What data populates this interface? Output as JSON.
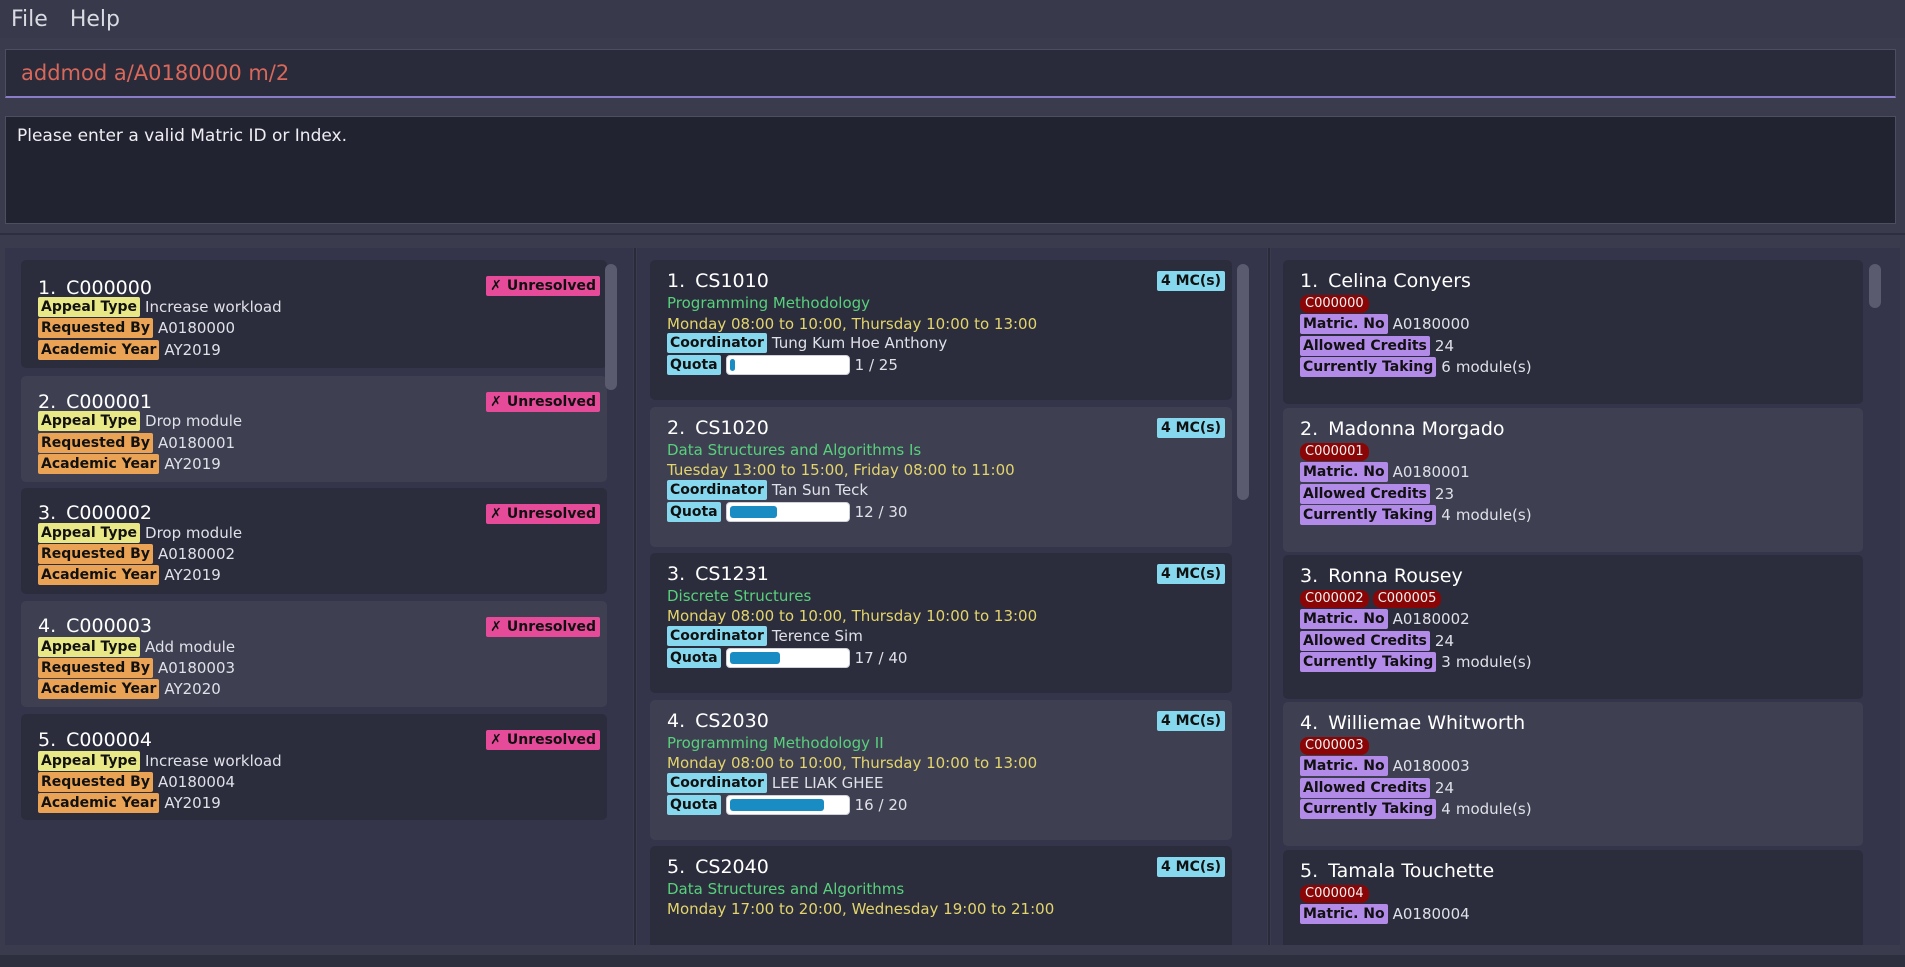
{
  "menu": {
    "file": "File",
    "help": "Help"
  },
  "command": {
    "value": "addmod a/A0180000 m/2"
  },
  "result": {
    "text": "Please enter a valid Matric ID or Index."
  },
  "appeals": [
    {
      "index": "1.",
      "id": "C000000",
      "status": "Unresolved",
      "appeal_type_label": "Appeal Type",
      "appeal_type": "Increase workload",
      "requested_by_label": "Requested By",
      "requested_by": "A0180000",
      "academic_year_label": "Academic Year",
      "academic_year": "AY2019"
    },
    {
      "index": "2.",
      "id": "C000001",
      "status": "Unresolved",
      "appeal_type_label": "Appeal Type",
      "appeal_type": "Drop module",
      "requested_by_label": "Requested By",
      "requested_by": "A0180001",
      "academic_year_label": "Academic Year",
      "academic_year": "AY2019"
    },
    {
      "index": "3.",
      "id": "C000002",
      "status": "Unresolved",
      "appeal_type_label": "Appeal Type",
      "appeal_type": "Drop module",
      "requested_by_label": "Requested By",
      "requested_by": "A0180002",
      "academic_year_label": "Academic Year",
      "academic_year": "AY2019"
    },
    {
      "index": "4.",
      "id": "C000003",
      "status": "Unresolved",
      "appeal_type_label": "Appeal Type",
      "appeal_type": "Add module",
      "requested_by_label": "Requested By",
      "requested_by": "A0180003",
      "academic_year_label": "Academic Year",
      "academic_year": "AY2020"
    },
    {
      "index": "5.",
      "id": "C000004",
      "status": "Unresolved",
      "appeal_type_label": "Appeal Type",
      "appeal_type": "Increase workload",
      "requested_by_label": "Requested By",
      "requested_by": "A0180004",
      "academic_year_label": "Academic Year",
      "academic_year": "AY2019"
    }
  ],
  "modules": [
    {
      "index": "1.",
      "code": "CS1010",
      "mc": "4 MC(s)",
      "name": "Programming Methodology",
      "schedule": "Monday 08:00 to 10:00, Thursday 10:00 to 13:00",
      "coordinator_label": "Coordinator",
      "coordinator": "Tung Kum Hoe Anthony",
      "quota_label": "Quota",
      "quota": "1 / 25",
      "quota_fill": 0.04
    },
    {
      "index": "2.",
      "code": "CS1020",
      "mc": "4 MC(s)",
      "name": "Data Structures and Algorithms Is",
      "schedule": "Tuesday 13:00 to 15:00, Friday 08:00 to 11:00",
      "coordinator_label": "Coordinator",
      "coordinator": "Tan Sun Teck",
      "quota_label": "Quota",
      "quota": "12 / 30",
      "quota_fill": 0.4
    },
    {
      "index": "3.",
      "code": "CS1231",
      "mc": "4 MC(s)",
      "name": "Discrete Structures",
      "schedule": "Monday 08:00 to 10:00, Thursday 10:00 to 13:00",
      "coordinator_label": "Coordinator",
      "coordinator": "Terence Sim",
      "quota_label": "Quota",
      "quota": "17 / 40",
      "quota_fill": 0.425
    },
    {
      "index": "4.",
      "code": "CS2030",
      "mc": "4 MC(s)",
      "name": "Programming Methodology II",
      "schedule": "Monday 08:00 to 10:00, Thursday 10:00 to 13:00",
      "coordinator_label": "Coordinator",
      "coordinator": "LEE LIAK GHEE",
      "quota_label": "Quota",
      "quota": "16 / 20",
      "quota_fill": 0.8
    },
    {
      "index": "5.",
      "code": "CS2040",
      "mc": "4 MC(s)",
      "name": "Data Structures and Algorithms",
      "schedule": "Monday 17:00 to 20:00, Wednesday 19:00 to 21:00"
    }
  ],
  "students": [
    {
      "index": "1.",
      "name": "Celina Conyers",
      "codes": [
        "C000000"
      ],
      "matric_label": "Matric. No",
      "matric": "A0180000",
      "credits_label": "Allowed Credits",
      "credits": "24",
      "taking_label": "Currently Taking",
      "taking": "6",
      "taking_unit": "module(s)"
    },
    {
      "index": "2.",
      "name": "Madonna Morgado",
      "codes": [
        "C000001"
      ],
      "matric_label": "Matric. No",
      "matric": "A0180001",
      "credits_label": "Allowed Credits",
      "credits": "23",
      "taking_label": "Currently Taking",
      "taking": "4",
      "taking_unit": "module(s)"
    },
    {
      "index": "3.",
      "name": "Ronna Rousey",
      "codes": [
        "C000002",
        "C000005"
      ],
      "matric_label": "Matric. No",
      "matric": "A0180002",
      "credits_label": "Allowed Credits",
      "credits": "24",
      "taking_label": "Currently Taking",
      "taking": "3",
      "taking_unit": "module(s)"
    },
    {
      "index": "4.",
      "name": "Williemae Whitworth",
      "codes": [
        "C000003"
      ],
      "matric_label": "Matric. No",
      "matric": "A0180003",
      "credits_label": "Allowed Credits",
      "credits": "24",
      "taking_label": "Currently Taking",
      "taking": "4",
      "taking_unit": "module(s)"
    },
    {
      "index": "5.",
      "name": "Tamala Touchette",
      "codes": [
        "C000004"
      ],
      "matric_label": "Matric. No",
      "matric": "A0180004"
    }
  ],
  "colors": {
    "unresolved": "#e64b9a",
    "appeal_type_tag": "#e9e886",
    "requested_tag": "#eaa355",
    "module_tag": "#86d8ef",
    "student_tag": "#b28be8",
    "code_badge": "#8a0606",
    "module_name": "#58d07c",
    "schedule": "#e3d46c",
    "command_text": "#d8685a"
  },
  "icons": {
    "unresolved": "x-icon"
  }
}
